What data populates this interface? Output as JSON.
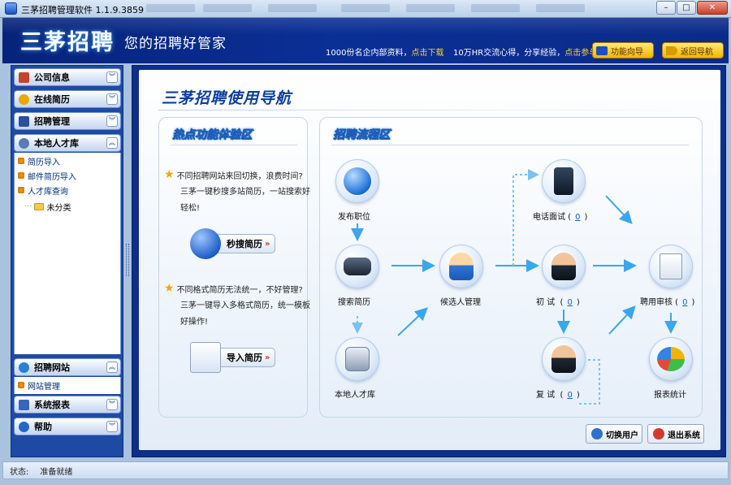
{
  "window": {
    "title": "三茅招聘管理软件 1.1.9.3859",
    "btn_min": "–",
    "btn_max": "□",
    "btn_close": "✕"
  },
  "header": {
    "logo": "三茅招聘",
    "slogan": "您的招聘好管家",
    "info1_text": "1000份名企内部资料，",
    "info1_link": "点击下载",
    "info2_text": "10万HR交流心得，分享经验，",
    "info2_link": "点击参与",
    "guide_label": "功能向导",
    "back_label": "返回导航"
  },
  "sidebar": {
    "groups_top": [
      {
        "label": "公司信息",
        "icon": "building-icon"
      },
      {
        "label": "在线简历",
        "icon": "user-icon"
      },
      {
        "label": "招聘管理",
        "icon": "document-icon"
      },
      {
        "label": "本地人才库",
        "icon": "people-icon"
      }
    ],
    "talent_items": [
      "简历导入",
      "邮件简历导入",
      "人才库查询"
    ],
    "tree_folder": "未分类",
    "groups_bottom": [
      {
        "label": "招聘网站",
        "icon": "globe-icon"
      },
      {
        "label": "系统报表",
        "icon": "report-icon"
      },
      {
        "label": "帮助",
        "icon": "help-icon"
      }
    ],
    "site_item": "网站管理"
  },
  "main": {
    "title": "三茅招聘使用导航",
    "hot": {
      "heading": "热点功能体验区",
      "q1": "不同招聘网站来回切换，浪费时间?",
      "a1": "三茅一键秒搜多站简历，一站搜索好轻松!",
      "btn1": "秒搜简历",
      "q2": "不同格式简历无法统一，不好管理?",
      "a2": "三茅一键导入多格式简历，统一模板好操作!",
      "btn2": "导入简历",
      "arrows": "»"
    },
    "flow": {
      "heading": "招聘流程区",
      "publish": "发布职位",
      "search": "搜索简历",
      "local": "本地人才库",
      "candidates": "候选人管理",
      "phone": "电话面试",
      "phone_count": "0",
      "first": "初 试",
      "first_count": "0",
      "second": "复 试",
      "second_count": "0",
      "approve": "聘用审核",
      "approve_count": "0",
      "report": "报表统计"
    },
    "switch_user": "切换用户",
    "exit": "退出系统"
  },
  "status": {
    "label": "状态:",
    "value": "准备就绪"
  },
  "colors": {
    "accent": "#0d3f9e",
    "header": "#0a2f95",
    "arrow": "#39a6ee",
    "link": "#ff3333"
  }
}
